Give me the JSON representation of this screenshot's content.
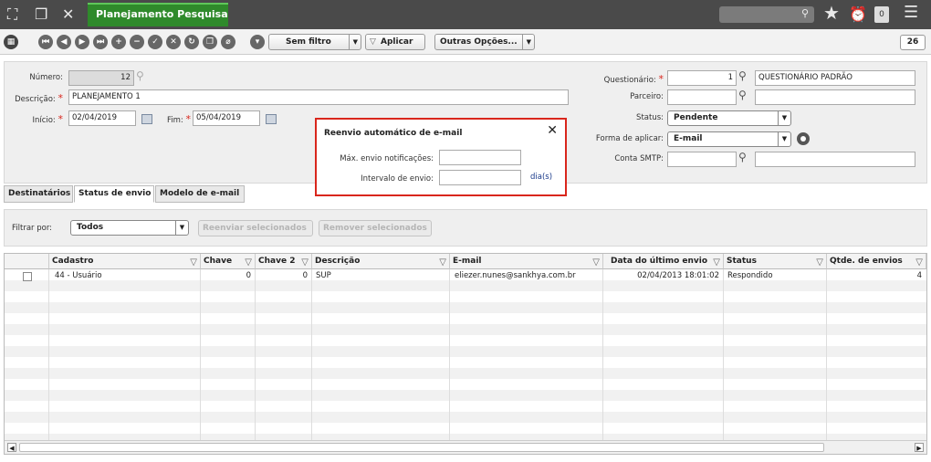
{
  "app": {
    "tab_title": "Planejamento Pesquisa",
    "badge": "0"
  },
  "toolbar": {
    "filter_label": "Sem filtro",
    "apply_label": "Aplicar",
    "more_label": "Outras Opções...",
    "count": "26"
  },
  "form": {
    "numero_label": "Número:",
    "numero_value": "12",
    "descricao_label": "Descrição:",
    "descricao_value": "PLANEJAMENTO 1",
    "inicio_label": "Início:",
    "inicio_value": "02/04/2019",
    "fim_label": "Fim:",
    "fim_value": "05/04/2019",
    "questionario_label": "Questionário:",
    "questionario_code": "1",
    "questionario_name": "QUESTIONÁRIO PADRÃO",
    "parceiro_label": "Parceiro:",
    "status_label": "Status:",
    "status_value": "Pendente",
    "forma_label": "Forma de aplicar:",
    "forma_value": "E-mail",
    "smtp_label": "Conta SMTP:"
  },
  "popup": {
    "title": "Reenvio automático de e-mail",
    "max_label": "Máx. envio notificações:",
    "interval_label": "Intervalo de envio:",
    "unit": "dia(s)"
  },
  "tabs": [
    "Destinatários",
    "Status de envio",
    "Modelo de e-mail"
  ],
  "filter": {
    "label": "Filtrar por:",
    "value": "Todos",
    "resend_label": "Reenviar selecionados",
    "remove_label": "Remover selecionados"
  },
  "grid": {
    "headers": [
      "Cadastro",
      "Chave",
      "Chave 2",
      "Descrição",
      "E-mail",
      "Data do último envio",
      "Status",
      "Qtde. de envios"
    ],
    "rows": [
      {
        "cadastro": "44 - Usuário",
        "chave": "0",
        "chave2": "0",
        "descricao": "SUP",
        "email": "eliezer.nunes@sankhya.com.br",
        "data": "02/04/2013 18:01:02",
        "status": "Respondido",
        "qtde": "4"
      }
    ]
  },
  "colors": {
    "accent_green": "#2f8a2b",
    "required_red": "#d9261c",
    "topbar": "#4a4a4a"
  }
}
